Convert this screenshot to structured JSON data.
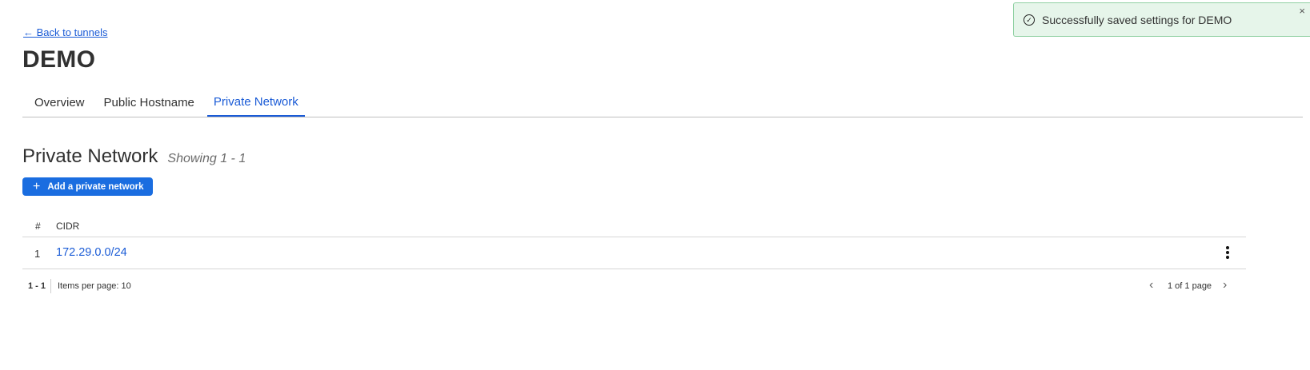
{
  "nav": {
    "back_link": "← Back to tunnels"
  },
  "tunnel": {
    "name": "DEMO"
  },
  "tabs": [
    {
      "label": "Overview",
      "active": false
    },
    {
      "label": "Public Hostname",
      "active": false
    },
    {
      "label": "Private Network",
      "active": true
    }
  ],
  "section": {
    "title": "Private Network",
    "showing": "Showing 1 - 1",
    "add_button": "Add a private network"
  },
  "table": {
    "columns": [
      "#",
      "CIDR"
    ],
    "rows": [
      {
        "index": "1",
        "cidr": "172.29.0.0/24"
      }
    ]
  },
  "pagination": {
    "range": "1 - 1",
    "items_per_page": "Items per page: 10",
    "page_info": "1 of 1 page"
  },
  "toast": {
    "message": "Successfully saved settings for DEMO",
    "close": "×"
  },
  "icons": {
    "add": "plus-icon",
    "row_menu": "kebab-menu-icon",
    "prev": "chevron-left-icon",
    "next": "chevron-right-icon",
    "success": "check-circle-icon",
    "close": "close-icon"
  },
  "colors": {
    "accent": "#1a5bd6",
    "button": "#1a6de0",
    "toast_bg": "#e6f5ea",
    "toast_border": "#8fd0a2"
  }
}
